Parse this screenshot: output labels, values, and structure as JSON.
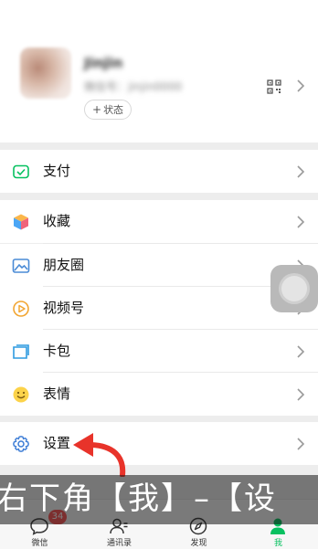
{
  "profile": {
    "nickname": "Jinjin",
    "wxid_label": "微信号：jinjin0000",
    "status_label": "状态"
  },
  "menu": {
    "pay": "支付",
    "favorites": "收藏",
    "moments": "朋友圈",
    "channels": "视频号",
    "cards": "卡包",
    "stickers": "表情",
    "settings": "设置"
  },
  "tabbar": {
    "chats": "微信",
    "contacts": "通讯录",
    "discover": "发现",
    "me": "我",
    "chats_badge": "34"
  },
  "subtitle": "右下角【我】–【设",
  "colors": {
    "brand_green": "#07c160",
    "badge_red": "#fa5151",
    "annotation_red": "#e8332a",
    "background": "#ededed"
  },
  "icons": {
    "pay": "wallet-check-icon",
    "favorites": "cube-icon",
    "moments": "landscape-photo-icon",
    "channels": "play-circle-icon",
    "cards": "card-wallet-icon",
    "stickers": "smiley-icon",
    "settings": "gear-icon"
  }
}
